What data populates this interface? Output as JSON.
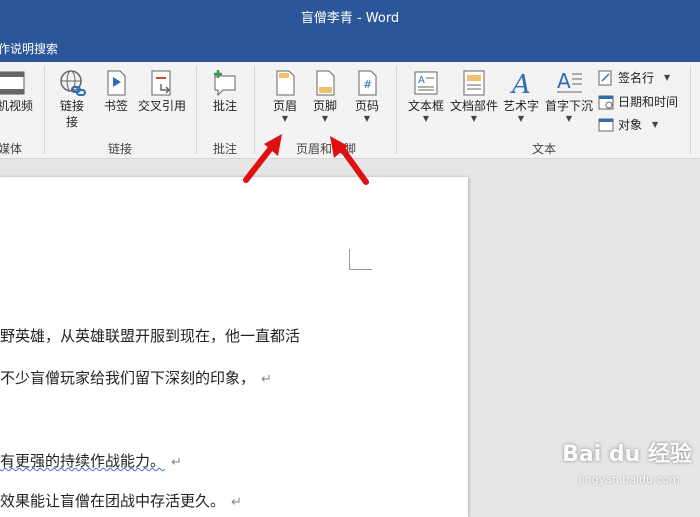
{
  "window": {
    "title": "盲僧李青 - Word",
    "tell_me": "作说明搜索"
  },
  "ribbon": {
    "media": {
      "button": "机视频",
      "group": "媒体"
    },
    "links": {
      "link": "链接",
      "link2": "接",
      "bookmark": "书签",
      "crossref": "交叉引用",
      "group": "链接"
    },
    "comments": {
      "comment": "批注",
      "group": "批注"
    },
    "header_footer": {
      "header": "页眉",
      "footer": "页脚",
      "page_number": "页码",
      "group": "页眉和页脚"
    },
    "text": {
      "textbox": "文本框",
      "quickparts": "文档部件",
      "wordart": "艺术字",
      "dropcap": "首字下沉",
      "signature": "签名行",
      "datetime": "日期和时间",
      "object": "对象",
      "group": "文本"
    }
  },
  "document": {
    "lines": [
      "野英雄，从英雄联盟开服到现在，他一直都活",
      "不少盲僧玩家给我们留下深刻的印象，",
      "有更强的持续作战能力。",
      "效果能让盲僧在团战中存活更久。"
    ],
    "para_mark": "↵"
  },
  "watermark": {
    "brand": "Bai du 经验",
    "url": "jingyan.baidu.com"
  }
}
